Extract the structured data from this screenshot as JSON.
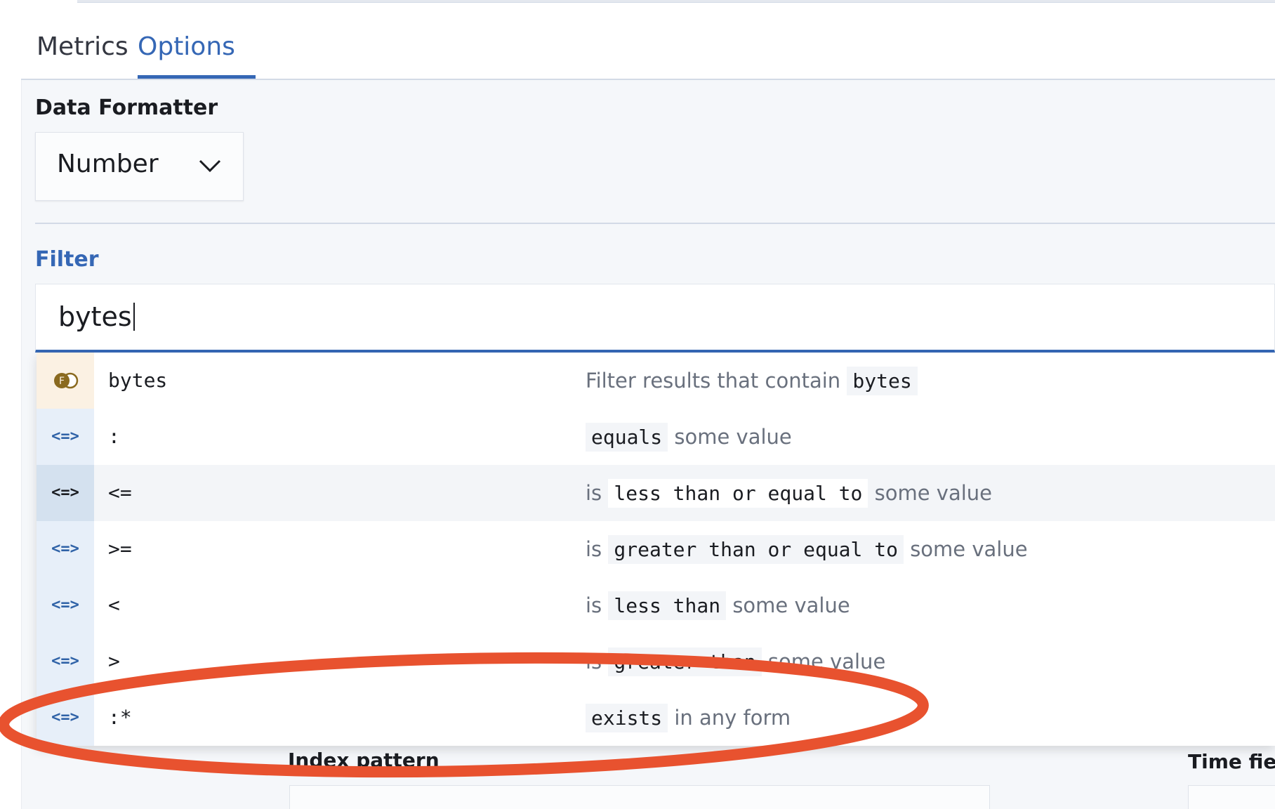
{
  "tabs": [
    {
      "label": "Metrics",
      "active": false
    },
    {
      "label": "Options",
      "active": true
    }
  ],
  "data_formatter": {
    "label": "Data Formatter",
    "value": "Number"
  },
  "filter": {
    "label": "Filter",
    "value": "bytes"
  },
  "suggestions": [
    {
      "type": "field",
      "icon": "field-icon",
      "text": "bytes",
      "desc_prefix": "Filter results that contain",
      "desc_code": "bytes",
      "desc_suffix": ""
    },
    {
      "type": "operator",
      "icon": "<=>",
      "text": ":",
      "desc_prefix": "",
      "desc_code": "equals",
      "desc_suffix": "some value"
    },
    {
      "type": "operator",
      "icon": "<=>",
      "text": "<=",
      "desc_prefix": "is",
      "desc_code": "less than or equal to",
      "desc_suffix": "some value",
      "active": true
    },
    {
      "type": "operator",
      "icon": "<=>",
      "text": ">=",
      "desc_prefix": "is",
      "desc_code": "greater than or equal to",
      "desc_suffix": "some value"
    },
    {
      "type": "operator",
      "icon": "<=>",
      "text": "<",
      "desc_prefix": "is",
      "desc_code": "less than",
      "desc_suffix": "some value"
    },
    {
      "type": "operator",
      "icon": "<=>",
      "text": ">",
      "desc_prefix": "is",
      "desc_code": "greater than",
      "desc_suffix": "some value"
    },
    {
      "type": "operator",
      "icon": "<=>",
      "text": ":*",
      "desc_prefix": "",
      "desc_code": "exists",
      "desc_suffix": "in any form"
    }
  ],
  "below": {
    "index_pattern_label": "Index pattern",
    "time_field_label": "Time fiel"
  },
  "colors": {
    "accent": "#3567b5",
    "annotation": "#e8522f",
    "field_icon": "#8a6a1f"
  }
}
